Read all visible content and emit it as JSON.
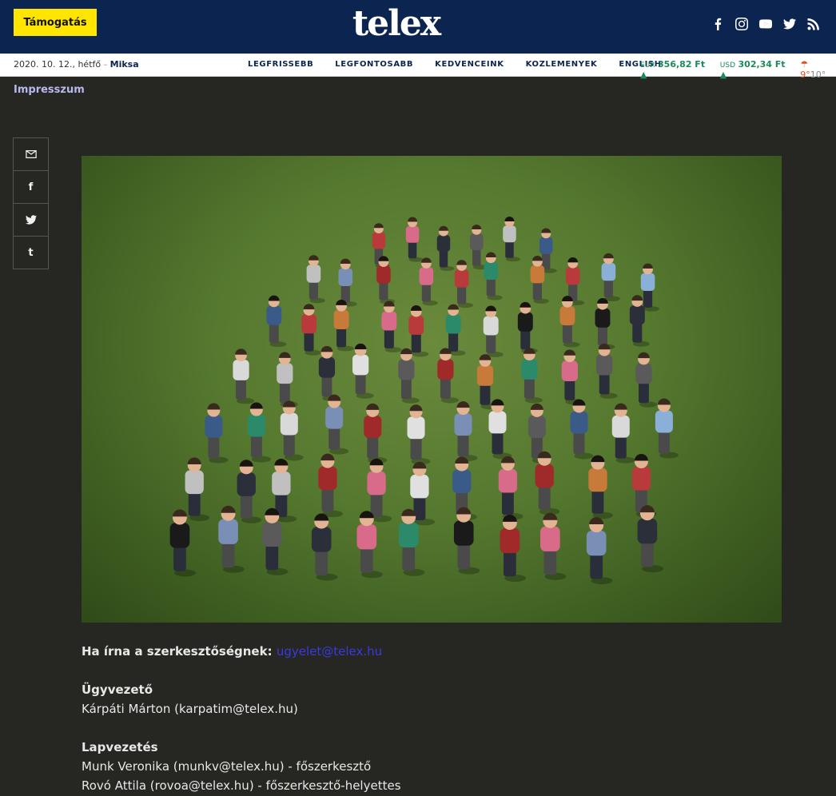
{
  "header": {
    "support_label": "Támogatás",
    "logo_text": "telex",
    "socials": [
      "facebook-icon",
      "instagram-icon",
      "youtube-icon",
      "twitter-icon",
      "rss-icon"
    ]
  },
  "subbar": {
    "date": "2020. 10. 12., hétfő",
    "separator": "–",
    "nameday": "Miksa",
    "nav": [
      "LEGFRISSEBB",
      "LEGFONTOSABB",
      "KEDVENCEINK",
      "KOZLEMENYEK",
      "ENGLISH"
    ],
    "eur_label": "EUR",
    "eur_value": "356,82 Ft",
    "usd_label": "USD",
    "usd_value": "302,34 Ft",
    "temp_low": "9°",
    "temp_high": "10°"
  },
  "breadcrumb": "Impresszum",
  "share": {
    "email_icon": "mail-icon",
    "facebook_glyph": "f",
    "twitter_icon": "twitter-icon",
    "tumblr_glyph": "t"
  },
  "content": {
    "contact_label": "Ha írna a szerkesztőségnek:",
    "contact_email": "ugyelet@telex.hu",
    "sections": [
      {
        "title": "Ügyvezető",
        "lines": [
          "Kárpáti Márton (karpatim@telex.hu)"
        ]
      },
      {
        "title": "Lapvezetés",
        "lines": [
          "Munk Veronika (munkv@telex.hu) - főszerkesztő",
          "Rovó Attila (rovoa@telex.hu) - főszerkesztő-helyettes"
        ]
      }
    ]
  },
  "colors": {
    "header_bg": "#0c2450",
    "accent_yellow": "#ffe500",
    "page_bg": "#262622",
    "link_blue": "#3a3ae0",
    "ticker_green": "#1d8a5a"
  }
}
